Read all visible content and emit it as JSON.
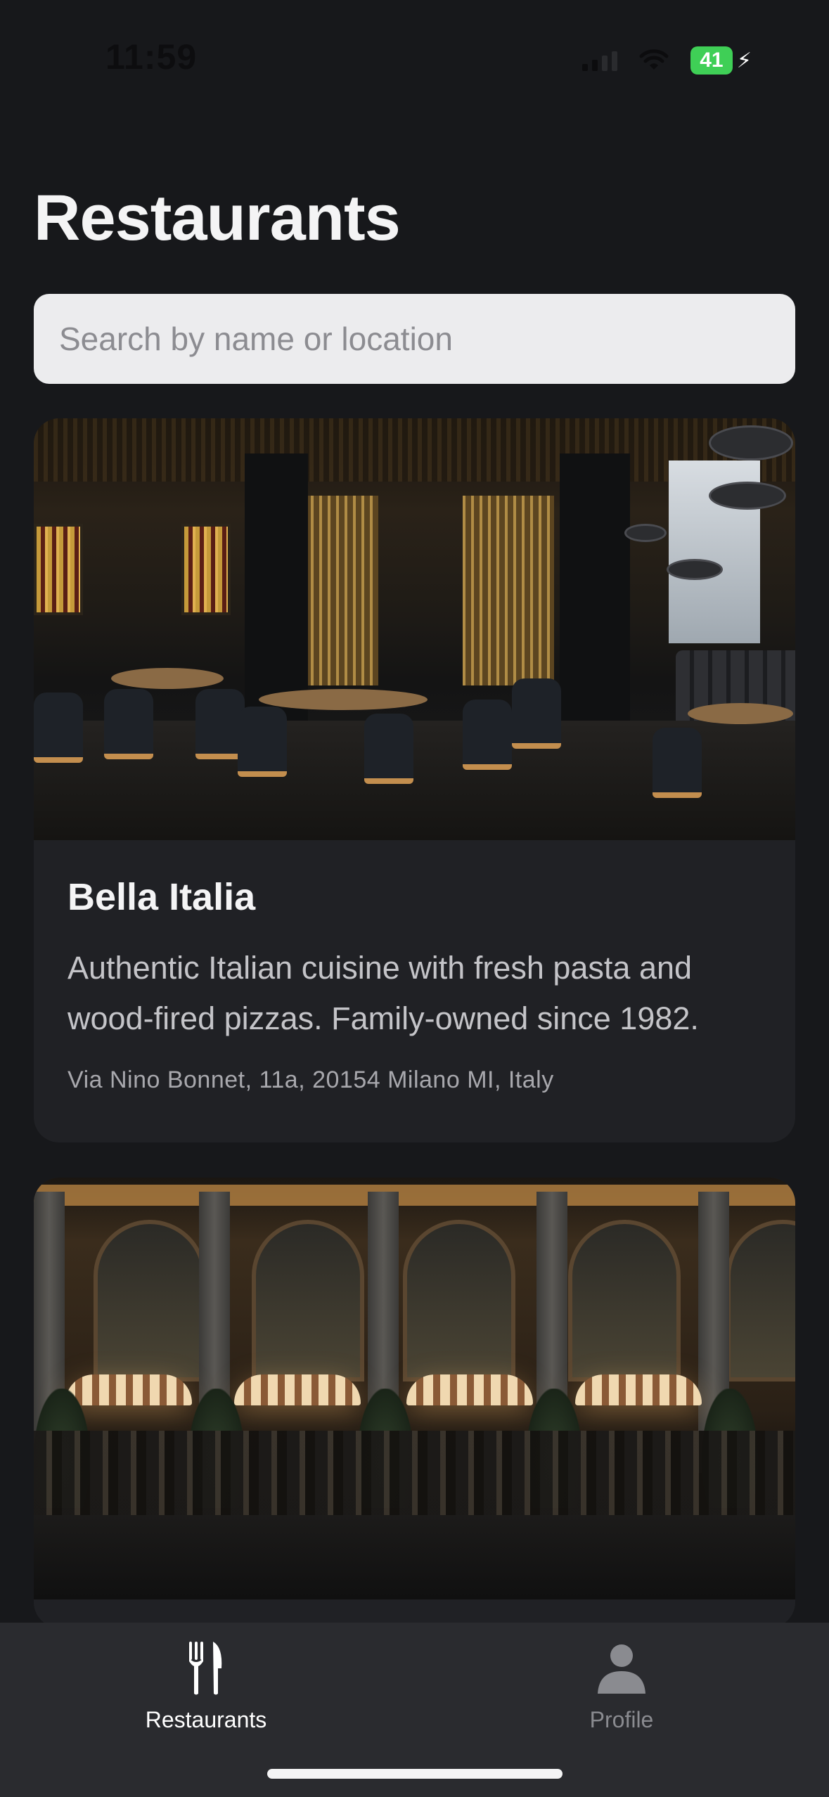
{
  "status_bar": {
    "time": "11:59",
    "battery": "41",
    "icons": [
      "signal-icon",
      "wifi-icon",
      "battery-charging-icon"
    ]
  },
  "page": {
    "title": "Restaurants"
  },
  "search": {
    "placeholder": "Search by name or location",
    "value": ""
  },
  "restaurants": [
    {
      "name": "Bella Italia",
      "description": "Authentic Italian cuisine with fresh pasta and wood-fired pizzas. Family-owned since 1982.",
      "address": "Via Nino Bonnet, 11a, 20154 Milano MI, Italy"
    }
  ],
  "tab_bar": {
    "tabs": [
      {
        "label": "Restaurants",
        "icon": "fork-knife-icon",
        "active": true
      },
      {
        "label": "Profile",
        "icon": "person-icon",
        "active": false
      }
    ],
    "colors": {
      "active": "#ffffff",
      "inactive": "#8a8b90"
    }
  }
}
